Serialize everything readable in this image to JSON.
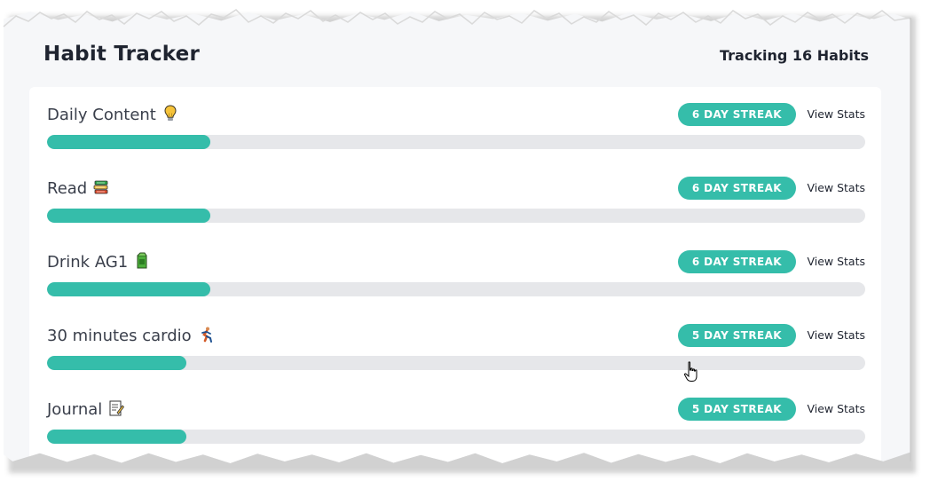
{
  "header": {
    "title": "Habit Tracker",
    "tracking": "Tracking 16 Habits"
  },
  "habits": [
    {
      "name": "Daily Content",
      "emoji_icon": "lightbulb-icon",
      "streak": "6 DAY STREAK",
      "action": "View Stats",
      "progress": 0.2
    },
    {
      "name": "Read",
      "emoji_icon": "books-icon",
      "streak": "6 DAY STREAK",
      "action": "View Stats",
      "progress": 0.2
    },
    {
      "name": "Drink AG1",
      "emoji_icon": "green-drink-icon",
      "streak": "6 DAY STREAK",
      "action": "View Stats",
      "progress": 0.2
    },
    {
      "name": "30 minutes cardio",
      "emoji_icon": "runner-icon",
      "streak": "5 DAY STREAK",
      "action": "View Stats",
      "progress": 0.17
    },
    {
      "name": "Journal",
      "emoji_icon": "memo-icon",
      "streak": "5 DAY STREAK",
      "action": "View Stats",
      "progress": 0.17
    }
  ],
  "colors": {
    "accent": "#35bdaa",
    "track": "#e6e7ea",
    "text": "#1f2430"
  }
}
